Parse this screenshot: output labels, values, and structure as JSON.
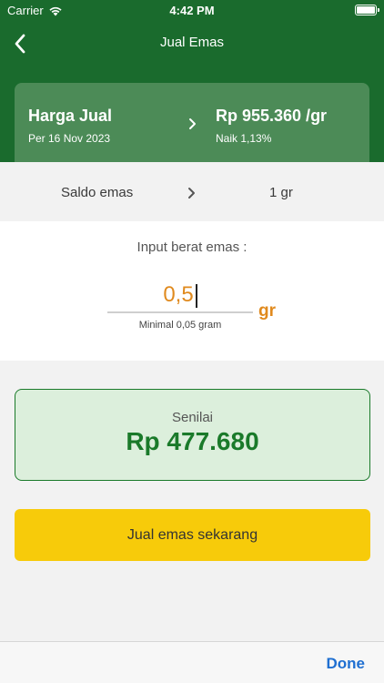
{
  "status_bar": {
    "carrier": "Carrier",
    "time": "4:42 PM",
    "wifi_icon": "wifi-icon",
    "battery_icon": "battery-icon"
  },
  "nav": {
    "title": "Jual Emas",
    "back_icon": "chevron-left-icon"
  },
  "price_card": {
    "title": "Harga Jual",
    "date": "Per 16 Nov 2023",
    "price": "Rp 955.360 /gr",
    "change": "Naik 1,13%",
    "chevron_icon": "chevron-right-icon"
  },
  "saldo": {
    "label": "Saldo emas",
    "value": "1 gr",
    "chevron_icon": "chevron-right-icon"
  },
  "input_panel": {
    "label": "Input berat emas :",
    "value": "0,5",
    "unit": "gr",
    "hint": "Minimal 0,05 gram"
  },
  "senilai": {
    "label": "Senilai",
    "value": "Rp 477.680"
  },
  "sell_button": {
    "label": "Jual emas sekarang"
  },
  "keyboard_toolbar": {
    "done_label": "Done"
  },
  "colors": {
    "header_green": "#1a6b2d",
    "card_green": "#4c8b57",
    "accent_orange": "#e08a1e",
    "value_green": "#1a7a2a",
    "button_yellow": "#f7cb0a",
    "done_blue": "#1f6fd1"
  }
}
